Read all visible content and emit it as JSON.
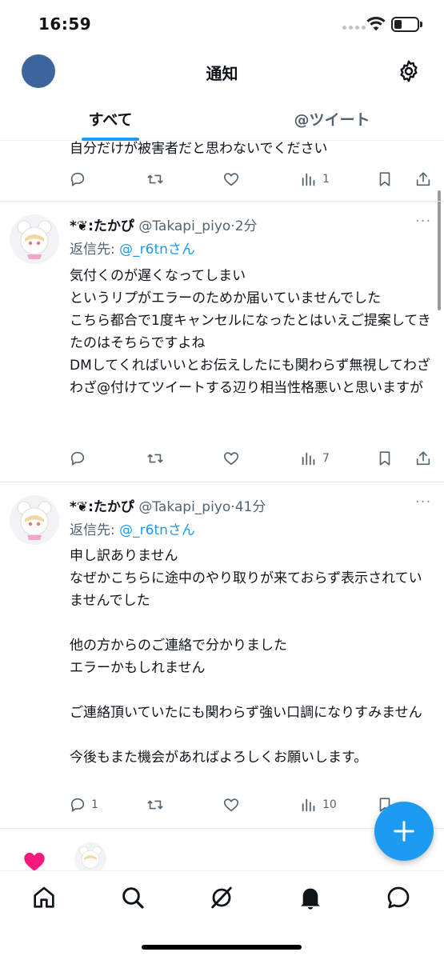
{
  "status_bar": {
    "time": "16:59"
  },
  "header": {
    "title": "通知"
  },
  "tabs": [
    {
      "label": "すべて",
      "selected": true
    },
    {
      "label": "@ツイート",
      "selected": false
    }
  ],
  "tweets": [
    {
      "text": "自分だけが被害者だと思わないでください",
      "views": "1",
      "replies": ""
    },
    {
      "display_name": "*❦:たかぴ",
      "handle": "@Takapi_piyo",
      "time": "·2分",
      "reply_label": "返信先: ",
      "reply_to": "@_r6tnさん",
      "text": "気付くのが遅くなってしまい\nというリプがエラーのためか届いていませんでした\nこちら都合で1度キャンセルになったとはいえご提案してきたのはそちらですよね\nDMしてくればいいとお伝えしたにも関わらず無視してわざわざ@付けてツイートする辺り相当性格悪いと思いますが",
      "views": "7",
      "replies": ""
    },
    {
      "display_name": "*❦:たかぴ",
      "handle": "@Takapi_piyo",
      "time": "·41分",
      "reply_label": "返信先: ",
      "reply_to": "@_r6tnさん",
      "text": "申し訳ありません\nなぜかこちらに途中のやり取りが来ておらず表示されていませんでした\n\n他の方からのご連絡で分かりました\nエラーかもしれません\n\nご連絡頂いていたにも関わらず強い口調になりすみません\n\n今後もまた機会があればよろしくお願いします。",
      "views": "10",
      "replies": "1"
    }
  ],
  "more_label": "···",
  "colors": {
    "accent": "#1d9bf0",
    "like_pink": "#f91880",
    "avatar_blue": "#3e649e",
    "secondary_text": "#536471"
  },
  "bottom_nav": [
    "home-icon",
    "search-icon",
    "spaces-icon",
    "notifications-icon",
    "messages-icon"
  ]
}
